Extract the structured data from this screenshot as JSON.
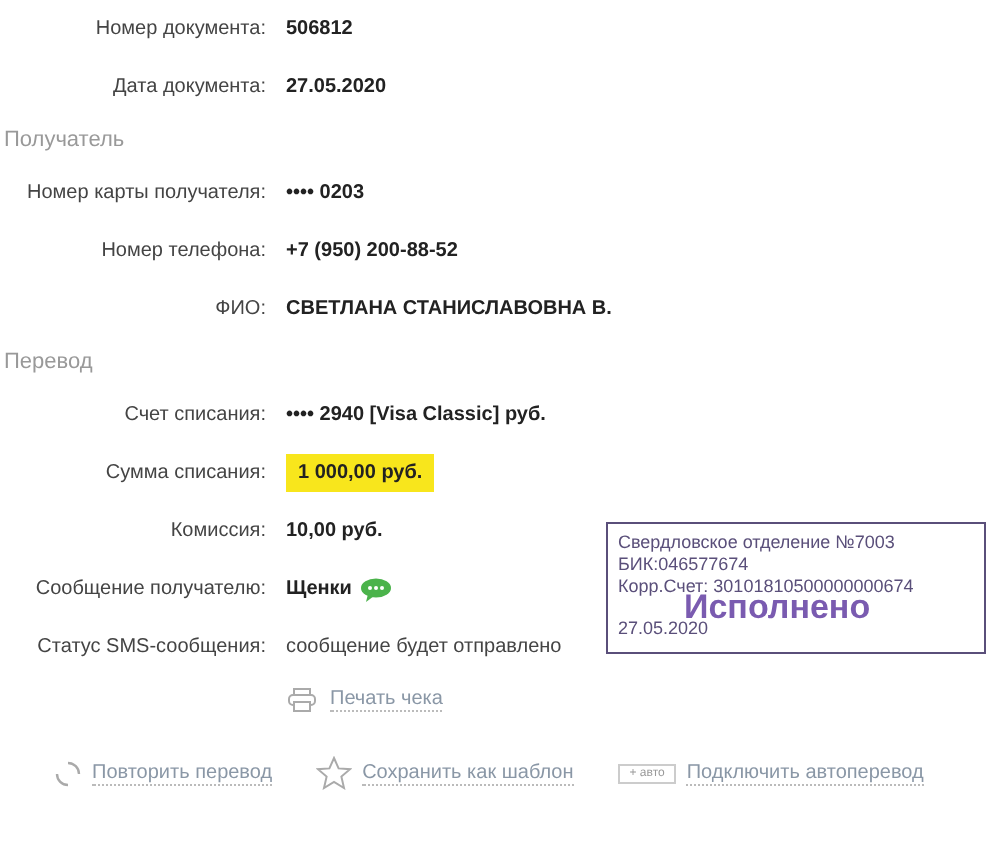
{
  "sections": [
    {
      "rows": [
        {
          "label": "Номер документа:",
          "value": "506812",
          "kind": "bold"
        },
        {
          "label": "Дата документа:",
          "value": "27.05.2020",
          "kind": "bold"
        }
      ]
    },
    {
      "title": "Получатель",
      "rows": [
        {
          "label": "Номер карты получателя:",
          "value": "•••• 0203",
          "kind": "bold"
        },
        {
          "label": "Номер телефона:",
          "value": "+7 (950) 200-88-52",
          "kind": "bold"
        },
        {
          "label": "ФИО:",
          "value": "СВЕТЛАНА СТАНИСЛАВОВНА В.",
          "kind": "bold"
        }
      ]
    },
    {
      "title": "Перевод",
      "rows": [
        {
          "label": "Счет списания:",
          "value": "•••• 2940  [Visa Classic]  руб.",
          "kind": "bold"
        },
        {
          "label": "Сумма списания:",
          "value": "1 000,00  руб.",
          "kind": "highlight"
        },
        {
          "label": "Комиссия:",
          "value": "10,00 руб.",
          "kind": "bold"
        },
        {
          "label": "Сообщение получателю:",
          "value": "Щенки",
          "kind": "message"
        },
        {
          "label": "Статус SMS-сообщения:",
          "value": "сообщение будет отправлено",
          "kind": "plain"
        }
      ]
    }
  ],
  "print_link": "Печать чека",
  "stamp": {
    "lines": [
      "Свердловское отделение №7003",
      "БИК:046577674",
      "Корр.Счет: 30101810500000000674"
    ],
    "status": "Исполнено",
    "date": "27.05.2020"
  },
  "actions": [
    {
      "kind": "repeat",
      "label": "Повторить перевод"
    },
    {
      "kind": "template",
      "label": "Сохранить как шаблон"
    },
    {
      "kind": "auto",
      "badge": "+ авто",
      "label": "Подключить автоперевод"
    }
  ]
}
